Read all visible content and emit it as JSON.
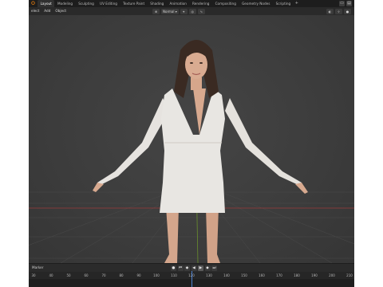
{
  "workspace_tabs": [
    "Layout",
    "Modeling",
    "Sculpting",
    "UV Editing",
    "Texture Paint",
    "Shading",
    "Animation",
    "Rendering",
    "Compositing",
    "Geometry Nodes",
    "Scripting"
  ],
  "active_tab_index": 0,
  "add_tab_label": "+",
  "header_menus": [
    "elect",
    "Add",
    "Object"
  ],
  "shading_mode": "Normal",
  "timeline": {
    "marker_label": "Marker",
    "ticks": [
      "30",
      "40",
      "50",
      "60",
      "70",
      "80",
      "90",
      "100",
      "110",
      "120",
      "130",
      "140",
      "150",
      "160",
      "170",
      "180",
      "190",
      "200",
      "210"
    ]
  },
  "colors": {
    "background": "#303030",
    "topbar": "#1d1d1d",
    "x_axis": "#9b3b3b",
    "y_axis": "#6a8f2d",
    "playhead": "#4f83d1",
    "dress": "#e8e6e2",
    "skin": "#d7a98f",
    "hair": "#3a2a22"
  }
}
